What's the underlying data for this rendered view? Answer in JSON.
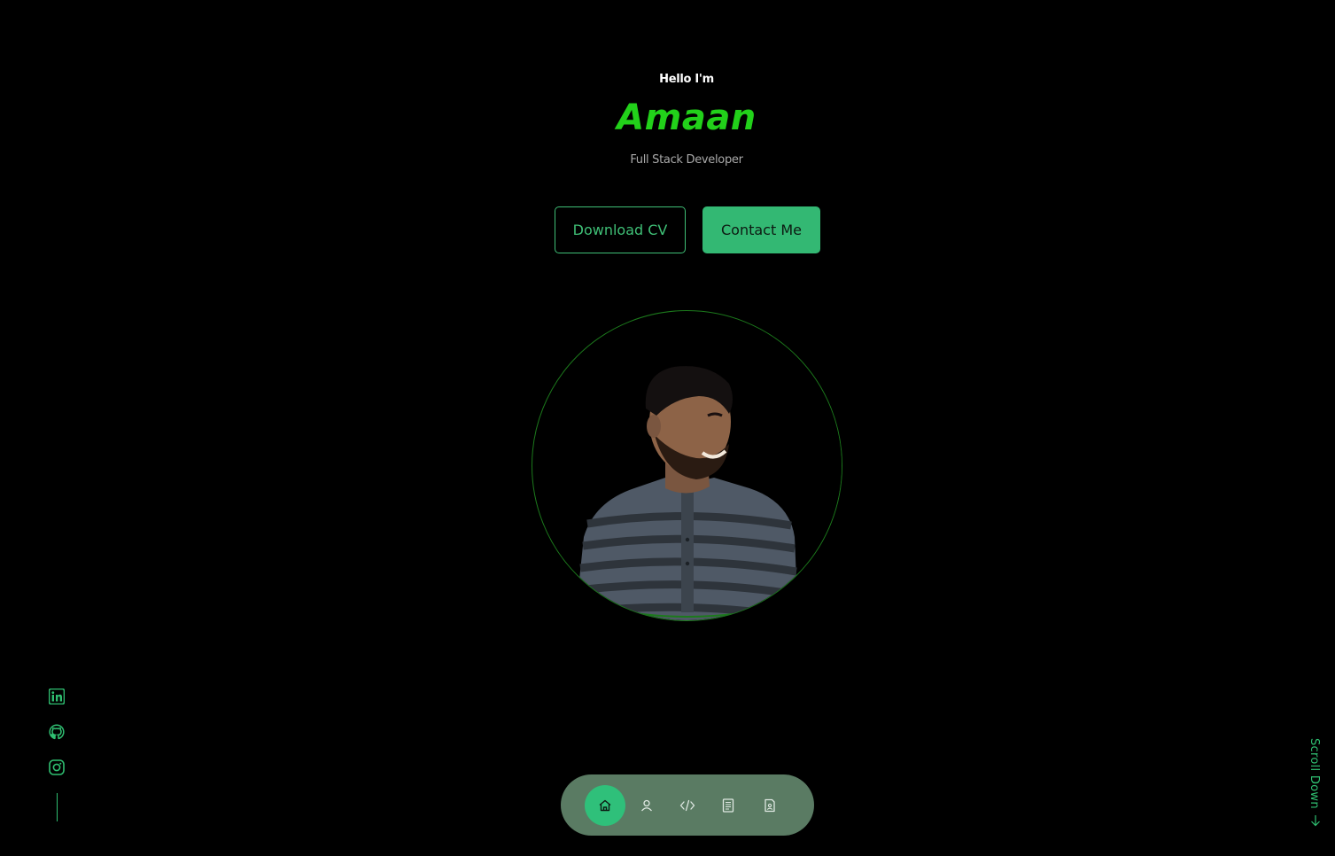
{
  "hero": {
    "greeting": "Hello I'm",
    "name": "Amaan",
    "role": "Full Stack Developer"
  },
  "buttons": {
    "download_cv": "Download CV",
    "contact_me": "Contact Me"
  },
  "social": [
    "linkedin-icon",
    "github-icon",
    "instagram-icon"
  ],
  "nav": {
    "items": [
      "home-icon",
      "user-icon",
      "code-icon",
      "resume-icon",
      "contact-file-icon"
    ],
    "active": "home-icon"
  },
  "scroll": {
    "label": "Scroll Down"
  },
  "colors": {
    "accent": "#33b873",
    "name": "#22d11a",
    "nav_bg": "#5a7b63"
  }
}
